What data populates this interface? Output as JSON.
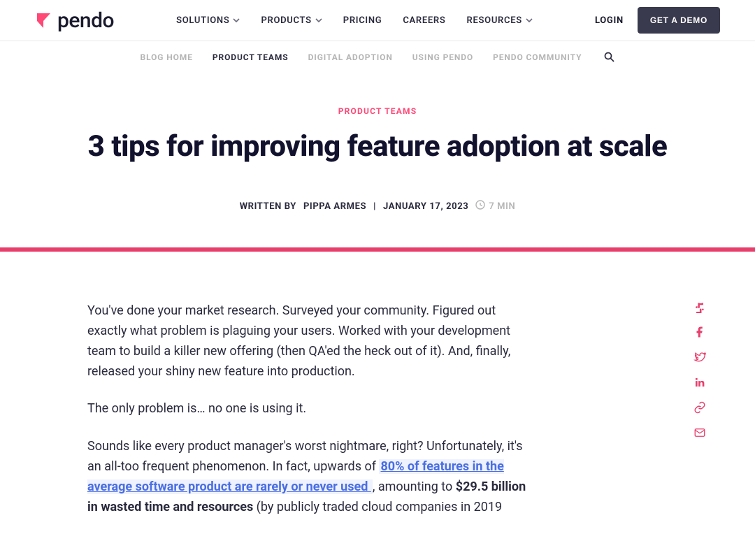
{
  "brand": {
    "name": "pendo"
  },
  "nav": {
    "items": [
      {
        "label": "SOLUTIONS",
        "dropdown": true
      },
      {
        "label": "PRODUCTS",
        "dropdown": true
      },
      {
        "label": "PRICING",
        "dropdown": false
      },
      {
        "label": "CAREERS",
        "dropdown": false
      },
      {
        "label": "RESOURCES",
        "dropdown": true
      }
    ],
    "login": "LOGIN",
    "demo": "GET A DEMO"
  },
  "subnav": {
    "items": [
      {
        "label": "BLOG HOME",
        "active": false
      },
      {
        "label": "PRODUCT TEAMS",
        "active": true
      },
      {
        "label": "DIGITAL ADOPTION",
        "active": false
      },
      {
        "label": "USING PENDO",
        "active": false
      },
      {
        "label": "PENDO COMMUNITY",
        "active": false
      }
    ]
  },
  "article": {
    "category": "PRODUCT TEAMS",
    "title": "3 tips for improving feature adoption at scale",
    "byline_prefix": "WRITTEN BY",
    "author": "PIPPA ARMES",
    "date": "JANUARY 17, 2023",
    "readtime": "7 MIN",
    "p1": "You've done your market research. Surveyed your community. Figured out exactly what problem is plaguing your users. Worked with your development team to build a killer new offering (then QA'ed the heck out of it). And, finally, released your shiny new feature into production.",
    "p2": "The only problem is… no one is using it.",
    "p3_a": "Sounds like every product manager's worst nightmare, right? Unfortunately, it's an all-too frequent phenomenon. In fact, upwards of ",
    "p3_link": " 80% of features in the average software product are rarely or never used ",
    "p3_b": ", amounting to ",
    "p3_strong": "$29.5 billion in wasted time and resources",
    "p3_c": " (by publicly traded cloud companies in 2019"
  }
}
